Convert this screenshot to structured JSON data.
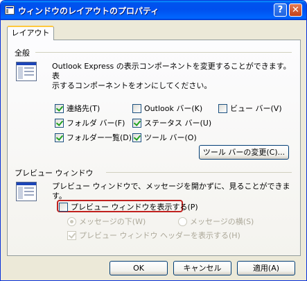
{
  "window": {
    "title": "ウィンドウのレイアウトのプロパティ",
    "help_label": "?",
    "close_label": "✕"
  },
  "tabs": [
    {
      "label": "レイアウト",
      "selected": true
    }
  ],
  "basic": {
    "label": "全般",
    "description_line1": "Outlook Express の表示コンポーネントを変更することができます。表",
    "description_line2": "示するコンポーネントをオンにしてください。",
    "checkboxes": [
      {
        "label": "連絡先(T)",
        "checked": true
      },
      {
        "label": "Outlook バー(K)",
        "checked": false
      },
      {
        "label": "ビュー バー(V)",
        "checked": false
      },
      {
        "label": "フォルダ バー(F)",
        "checked": true
      },
      {
        "label": "ステータス バー(U)",
        "checked": true
      },
      {
        "label": "フォルダー一覧(D)",
        "checked": true
      },
      {
        "label": "ツール バー(O)",
        "checked": true
      }
    ],
    "toolbar_button": "ツール バーの変更(C)..."
  },
  "preview": {
    "label": "プレビュー ウィンドウ",
    "description": "プレビュー ウィンドウで、メッセージを開かずに、見ることができます。",
    "show_checkbox": {
      "label": "プレビュー ウィンドウを表示する(P)",
      "checked": false
    },
    "radio_below": {
      "label": "メッセージの下(W)",
      "selected": true,
      "enabled": false
    },
    "radio_beside": {
      "label": "メッセージの横(S)",
      "selected": false,
      "enabled": false
    },
    "header_checkbox": {
      "label": "プレビュー ウィンドウ ヘッダーを表示する(H)",
      "checked": true,
      "enabled": false
    }
  },
  "footer": {
    "ok": "OK",
    "cancel": "キャンセル",
    "apply": "適用(A)"
  },
  "colors": {
    "titlebar": "#0053ee",
    "highlight_border": "#c0201e",
    "dialog_bg": "#ece9d8"
  }
}
